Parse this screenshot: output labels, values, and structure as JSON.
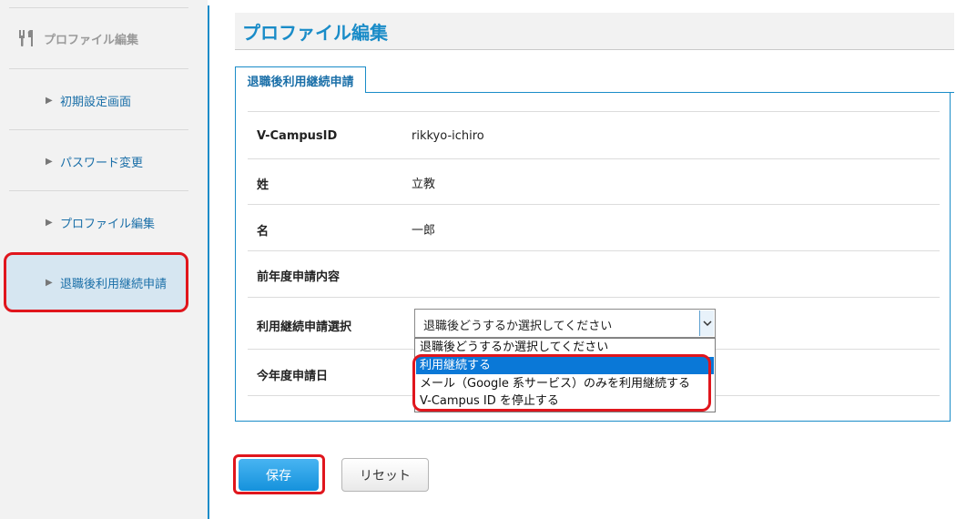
{
  "sidebar": {
    "heading": "プロファイル編集",
    "items": [
      {
        "label": "初期設定画面"
      },
      {
        "label": "パスワード変更"
      },
      {
        "label": "プロファイル編集"
      },
      {
        "label": "退職後利用継続申請"
      }
    ]
  },
  "main": {
    "title": "プロファイル編集",
    "tab_label": "退職後利用継続申請",
    "rows": [
      {
        "label": "V-CampusID",
        "value": "rikkyo-ichiro"
      },
      {
        "label": "姓",
        "value": "立教"
      },
      {
        "label": "名",
        "value": "一郎"
      },
      {
        "label": "前年度申請内容",
        "value": ""
      },
      {
        "label": "利用継続申請選択",
        "value": ""
      },
      {
        "label": "今年度申請日",
        "value": ""
      }
    ],
    "select": {
      "selected": "退職後どうするか選択してください",
      "options": [
        "退職後どうするか選択してください",
        "利用継続する",
        "メール（Google 系サービス）のみを利用継続する",
        "V-Campus ID を停止する"
      ],
      "highlighted_index": 1
    },
    "buttons": {
      "save": "保存",
      "reset": "リセット"
    }
  },
  "colors": {
    "accent": "#1a8cc8",
    "highlight_annotation": "#e0161d",
    "option_selected": "#0a78d7"
  }
}
